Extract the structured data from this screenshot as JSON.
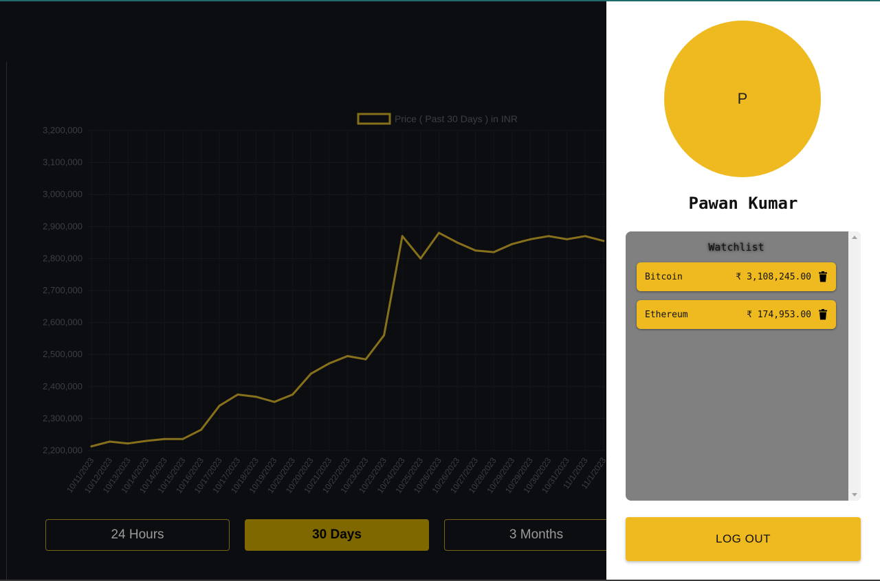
{
  "chart_data": {
    "type": "line",
    "series": [
      {
        "name": "Price ( Past 30 Days ) in INR",
        "x": [
          "10/11/2023",
          "10/12/2023",
          "10/13/2023",
          "10/14/2023",
          "10/14/2023",
          "10/15/2023",
          "10/16/2023",
          "10/17/2023",
          "10/17/2023",
          "10/18/2023",
          "10/19/2023",
          "10/20/2023",
          "10/20/2023",
          "10/21/2023",
          "10/22/2023",
          "10/23/2023",
          "10/23/2023",
          "10/24/2023",
          "10/25/2023",
          "10/26/2023",
          "10/26/2023",
          "10/27/2023",
          "10/28/2023",
          "10/29/2023",
          "10/29/2023",
          "10/30/2023",
          "10/31/2023",
          "11/1/2023",
          "11/1/2023"
        ],
        "values": [
          2213000,
          2228000,
          2222000,
          2230000,
          2236000,
          2236000,
          2265000,
          2340000,
          2375000,
          2368000,
          2352000,
          2375000,
          2440000,
          2472000,
          2495000,
          2485000,
          2560000,
          2870000,
          2800000,
          2880000,
          2850000,
          2825000,
          2820000,
          2845000,
          2860000,
          2870000,
          2860000,
          2870000,
          2855000
        ]
      }
    ],
    "ylim": [
      2200000,
      3200000
    ],
    "y_ticks": [
      "3,200,000",
      "3,100,000",
      "3,000,000",
      "2,900,000",
      "2,800,000",
      "2,700,000",
      "2,600,000",
      "2,500,000",
      "2,400,000",
      "2,300,000",
      "2,200,000"
    ],
    "x_ticks": [
      "10/11/2023",
      "10/12/2023",
      "10/13/2023",
      "10/14/2023",
      "10/14/2023",
      "10/15/2023",
      "10/16/2023",
      "10/17/2023",
      "10/17/2023",
      "10/18/2023",
      "10/19/2023",
      "10/20/2023",
      "10/20/2023",
      "10/21/2023",
      "10/22/2023",
      "10/23/2023",
      "10/23/2023",
      "10/24/2023",
      "10/25/2023",
      "10/26/2023",
      "10/26/2023",
      "10/27/2023",
      "10/28/2023",
      "10/29/2023",
      "10/29/2023",
      "10/30/2023",
      "10/31/2023",
      "11/1/2023",
      "11/1/2023"
    ],
    "legend": "Price ( Past 30 Days ) in INR",
    "line_color": "#87701c",
    "grid": true
  },
  "range_buttons": [
    {
      "label": "24 Hours",
      "active": false
    },
    {
      "label": "30 Days",
      "active": true
    },
    {
      "label": "3 Months",
      "active": false
    }
  ],
  "profile": {
    "avatar_letter": "P",
    "name": "Pawan Kumar"
  },
  "watchlist": {
    "title": "Watchlist",
    "items": [
      {
        "name": "Bitcoin",
        "price": "₹ 3,108,245.00"
      },
      {
        "name": "Ethereum",
        "price": "₹ 174,953.00"
      }
    ]
  },
  "logout_label": "LOG OUT",
  "colors": {
    "accent": "#eeba1f",
    "active_button": "#806800",
    "background": "#0c0d10"
  }
}
